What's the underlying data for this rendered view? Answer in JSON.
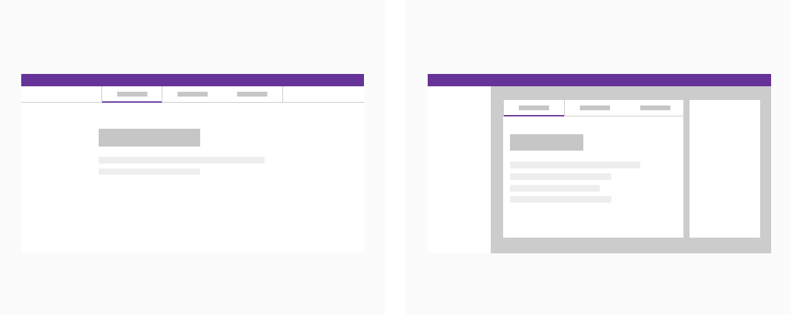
{
  "colors": {
    "accent": "#663399",
    "placeholder_dark": "#c6c6c6",
    "placeholder_light": "#eeeeee",
    "workspace_gray": "#cccccc"
  },
  "layouts": [
    {
      "id": "centered-tabs",
      "tabs": [
        "tab-1",
        "tab-2",
        "tab-3"
      ],
      "active_tab_index": 0,
      "content_lines": 2
    },
    {
      "id": "sidebar-workspace",
      "tabs": [
        "tab-1",
        "tab-2",
        "tab-3"
      ],
      "active_tab_index": 0,
      "content_lines": 4
    }
  ]
}
